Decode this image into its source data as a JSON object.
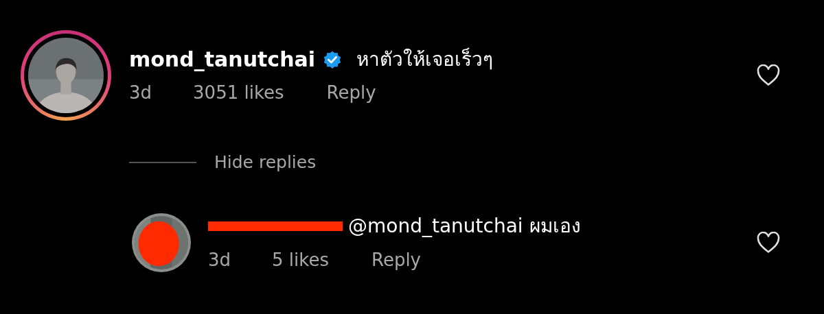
{
  "comment": {
    "username": "mond_tanutchai",
    "verified": true,
    "has_story": true,
    "text": "หาตัวให้เจอเร็วๆ",
    "time": "3d",
    "likes": "3051 likes",
    "reply": "Reply",
    "liked": false
  },
  "hide_replies": "Hide replies",
  "reply": {
    "redacted_name": true,
    "text": "@mond_tanutchai ผมเอง",
    "time": "3d",
    "likes": "5 likes",
    "reply": "Reply",
    "liked": false
  }
}
